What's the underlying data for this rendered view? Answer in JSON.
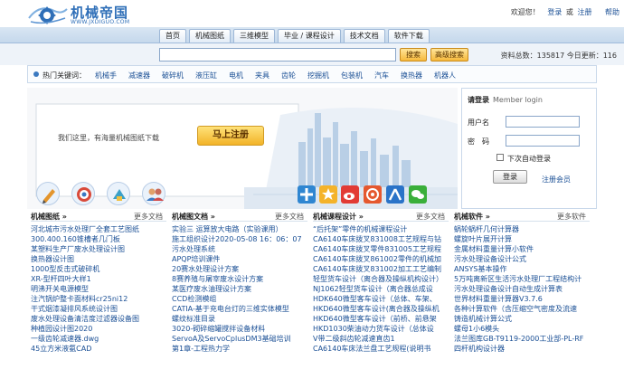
{
  "logo": {
    "cn": "机械帝国",
    "en": "WWW.JXDIGUO.COM"
  },
  "top_links": {
    "welcome": "欢迎您！",
    "login": "登录",
    "or": "或",
    "register": "注册",
    "help": "帮助"
  },
  "nav": {
    "tabs": [
      "首页",
      "机械图纸",
      "三维模型",
      "毕业 / 课程设计",
      "技术文档",
      "软件下载"
    ]
  },
  "search": {
    "value": "",
    "btn_search": "搜索",
    "btn_advanced": "高级搜索",
    "stats": "资料总数：135817 今日更新：116"
  },
  "hot": {
    "label": "热门关键词：",
    "items": [
      "机械手",
      "减速器",
      "破碎机",
      "液压缸",
      "电机",
      "夹具",
      "齿轮",
      "挖掘机",
      "包装机",
      "汽车",
      "换热器",
      "机器人"
    ]
  },
  "banner": {
    "text": "我们这里，有海量机械图纸下载",
    "register_button": "马上注册"
  },
  "login": {
    "title": "请登录",
    "subtitle": "Member login",
    "username_label": "用户名",
    "password_label": "密　码",
    "remember": "下次自动登录",
    "login_button": "登录",
    "register_link": "注册会员"
  },
  "columns": [
    {
      "title": "机械图纸 »",
      "more": "更多文档",
      "items": [
        "河北城市污水处理厂全套工艺图纸",
        "300.400.160锥槽者几门板",
        "某塑料生产厂废水处理设计图",
        "换热器设计图",
        "1000型反击式破碎机",
        "XR-型杆四叶大样1",
        "明沸开关电源模型",
        "注汽锅炉整卡面材料cr25ni12",
        "干式烟漆凝排风系统设计图",
        "废水处理设备清洁度过滤器设备图",
        "种植园设计图2020",
        "一级齿轮减速器.dwg",
        "45立方米液氨CAD"
      ]
    },
    {
      "title": "机械图文档 »",
      "more": "更多文档",
      "items": [
        "实验三  运算放大电路（实验课用）",
        "施工组织设计2020-05-08 16：06：07",
        "污水处理系统",
        "APQP培训课件",
        "20赛水处理设计方案",
        "8赛养殖与屠宰废水设计方案",
        "某医疗废水油理设计方案",
        "CCD检测模组",
        "CATIA-基于充电台灯的三维实体模型",
        "螺纹标准目录",
        "3020-砌碎缩罐搅拌设备材料",
        "ServoA及ServoCplusDM3基础培训",
        "第1章-工程热力学"
      ]
    },
    {
      "title": "机械课程设计 »",
      "more": "更多文档",
      "items": [
        "“后托架”零件的机械课程设计",
        "CA6140车床拨叉831008工艺规程与钻",
        "CA6140车床拨叉零件831005工艺规程",
        "CA6140车床拨叉861002零件的机械加",
        "CA6140车床拨叉831002加工工艺编制",
        "轻型货车设计（离合器及操纵机构设计）",
        "NJ1062轻型货车设计（离合器总成设",
        "HDK640微型客车设计（总体、车架、",
        "HKD640微型客车设计(离合器及操纵机",
        "HKD640微型客车设计（前桥、前悬架",
        "HKD1030柴油动力货车设计（总体设",
        "V带二级斜齿轮减速直齿1",
        "CA6140车床法兰盘工艺规程(说明书"
      ]
    },
    {
      "title": "机械软件 »",
      "more": "更多软件",
      "items": [
        "蜗轮蜗杆几何计算器",
        "螺旋叶片展开计算",
        "金属材料重量计算小软件",
        "污水处理设备设计公式",
        "ANSYS基本操作",
        "5万吨离新区生活污水处理厂工程结构计",
        "污水处理设备设计自动生成计算表",
        "世界材料重量计算器V3.7.6",
        "各种计算软件（含压缩空气密度及流速",
        "铸造机械计算公式",
        "螺母1小6模头",
        "法兰图库GB-T9119-2000工业部-PL-RF",
        "四杆机构设计器"
      ]
    }
  ]
}
